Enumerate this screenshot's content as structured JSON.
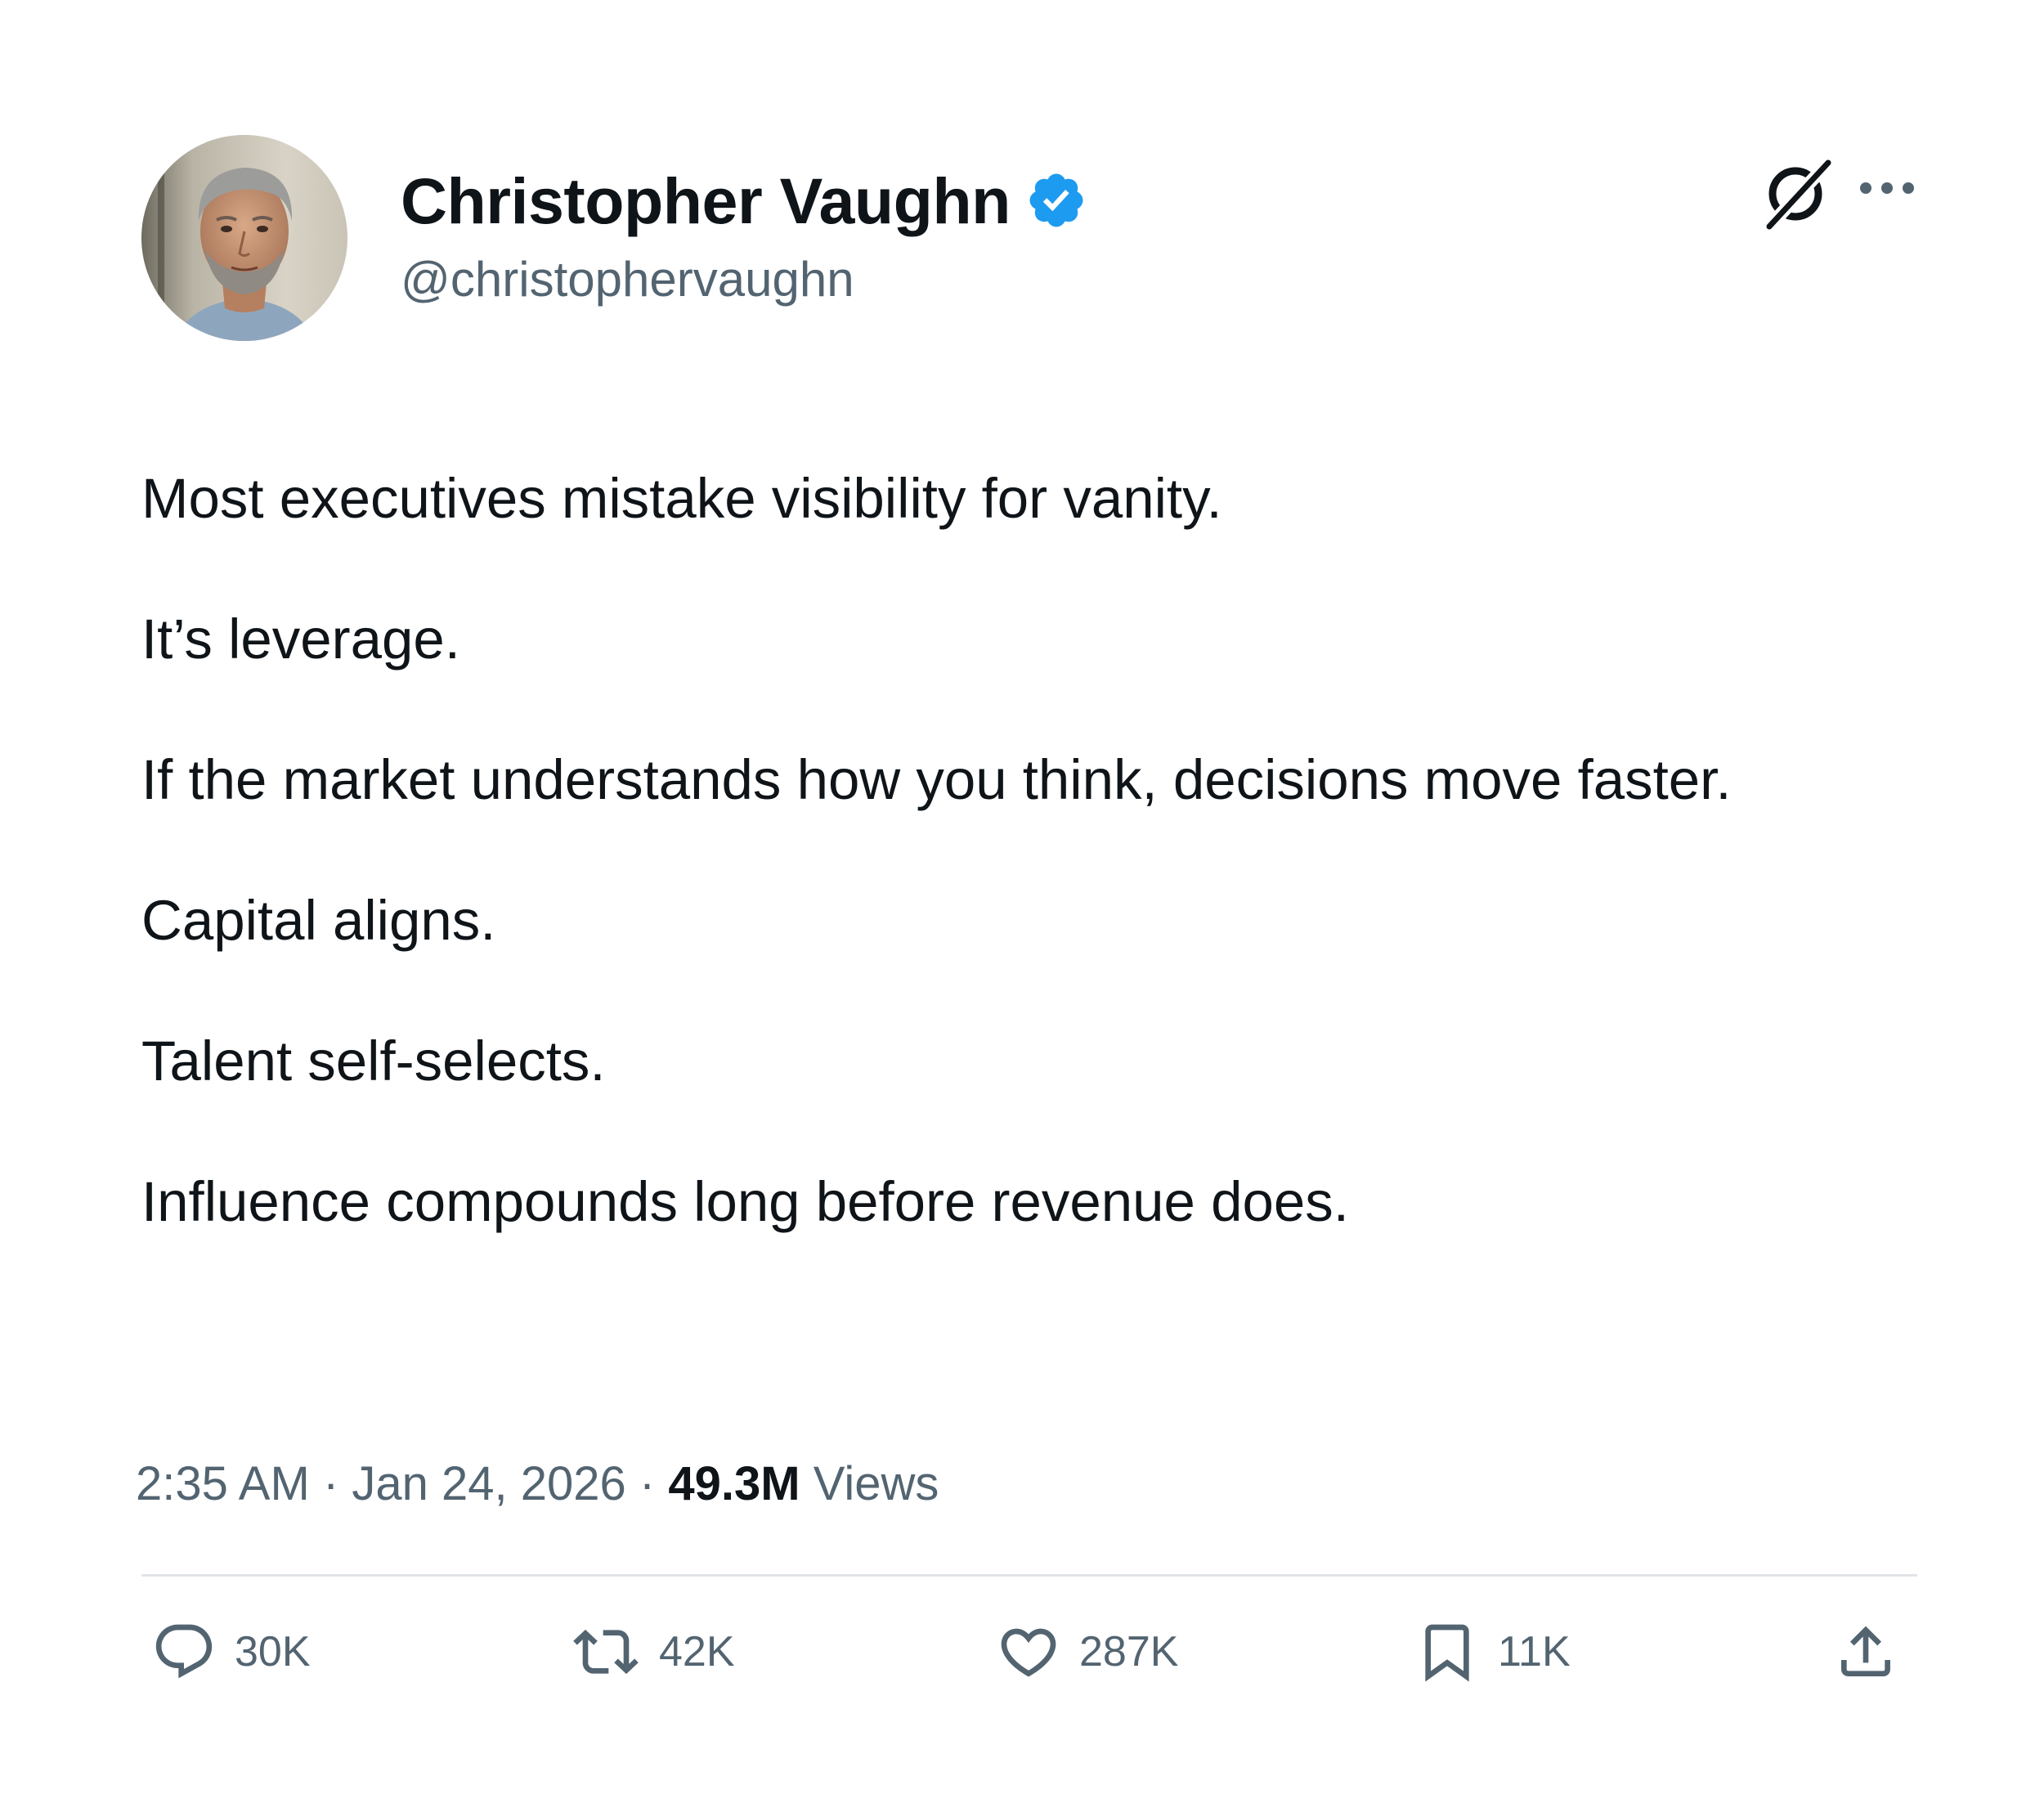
{
  "author": {
    "display_name": "Christopher Vaughn",
    "handle": "@christophervaughn",
    "verified": true,
    "verified_color": "#1d9bf0"
  },
  "header_icons": {
    "grok": "grok-icon",
    "more": "more-icon"
  },
  "tweet": {
    "paragraphs": [
      "Most executives mistake visibility for vanity.",
      "It’s leverage.",
      "If the market understands how you think, decisions move faster.",
      "Capital aligns.",
      "Talent self-selects.",
      "Influence compounds long before revenue does."
    ],
    "time": "2:35 AM",
    "separator": "·",
    "date": "Jan 24, 2026",
    "views_count": "49.3M",
    "views_label": "Views"
  },
  "actions": {
    "reply": {
      "icon": "reply-icon",
      "count": "30K"
    },
    "repost": {
      "icon": "repost-icon",
      "count": "42K"
    },
    "like": {
      "icon": "heart-icon",
      "count": "287K"
    },
    "bookmark": {
      "icon": "bookmark-icon",
      "count": "11K"
    },
    "share": {
      "icon": "share-icon"
    }
  },
  "colors": {
    "text_primary": "#0f1419",
    "text_secondary": "#536471",
    "divider": "#e1e4e7"
  }
}
